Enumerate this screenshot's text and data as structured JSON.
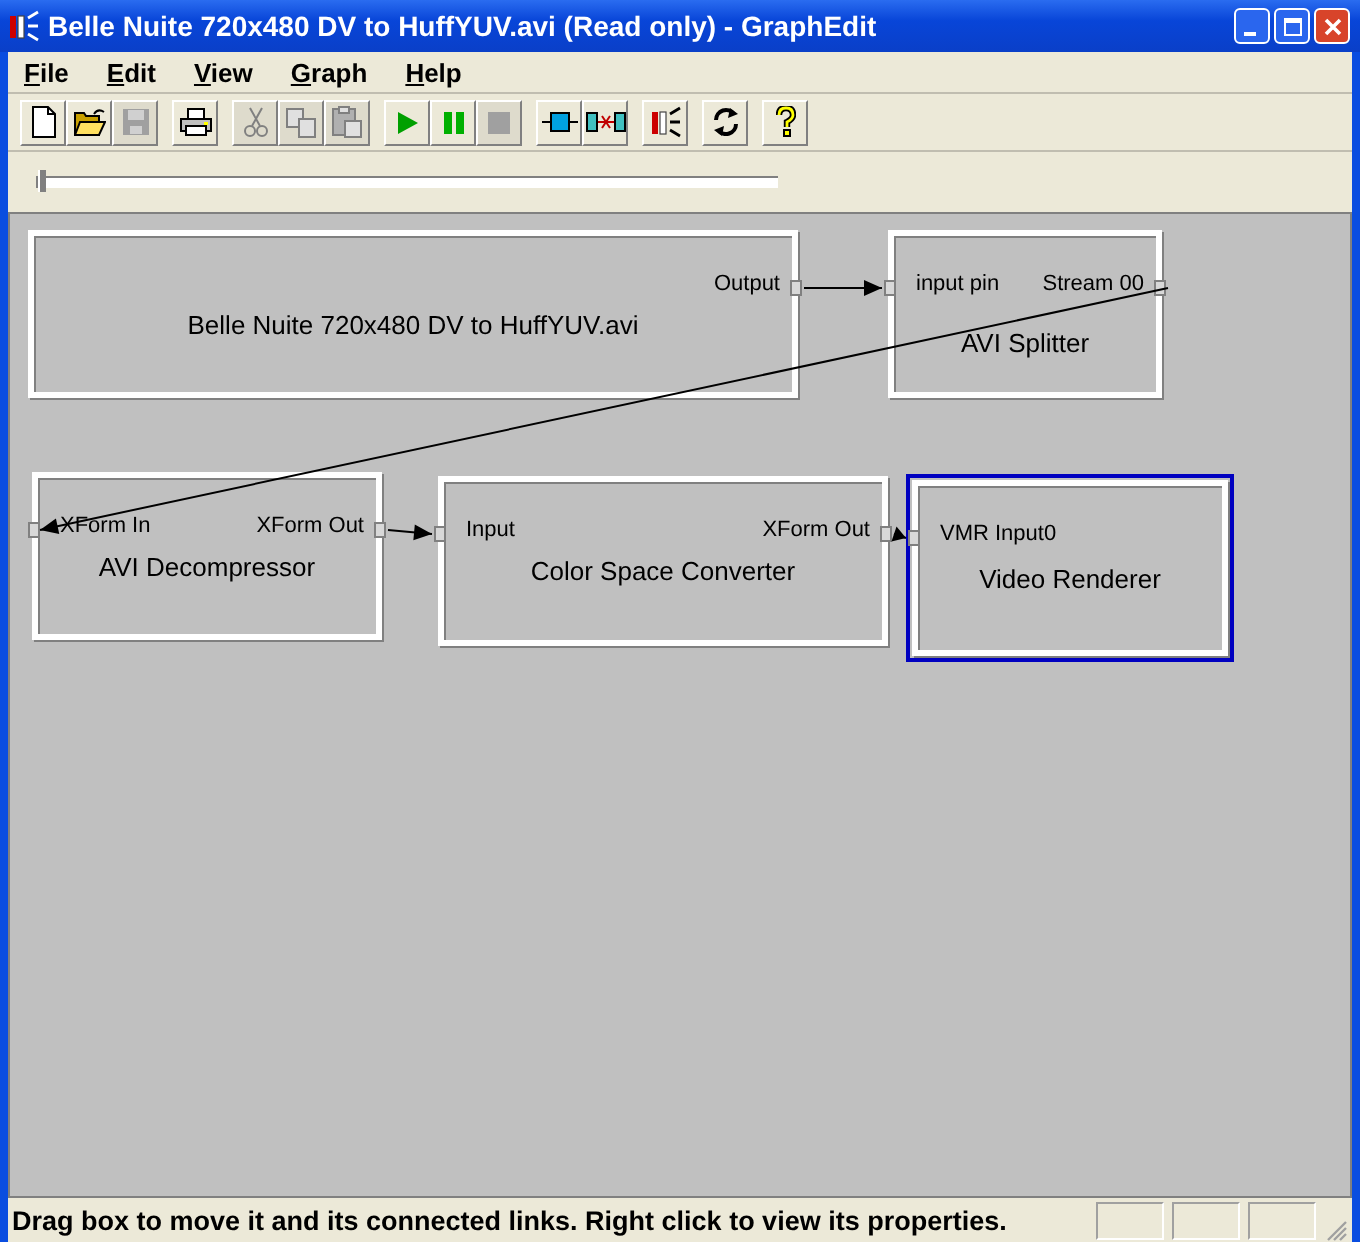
{
  "window": {
    "title": "Belle Nuite 720x480 DV to HuffYUV.avi (Read only) - GraphEdit"
  },
  "menu": [
    "File",
    "Edit",
    "View",
    "Graph",
    "Help"
  ],
  "toolbar_groups": [
    [
      {
        "kind": "new",
        "disabled": false
      },
      {
        "kind": "open",
        "disabled": false
      },
      {
        "kind": "save",
        "disabled": true
      }
    ],
    [
      {
        "kind": "print",
        "disabled": false
      }
    ],
    [
      {
        "kind": "cut",
        "disabled": true
      },
      {
        "kind": "copy",
        "disabled": true
      },
      {
        "kind": "paste",
        "disabled": true
      }
    ],
    [
      {
        "kind": "play",
        "disabled": false
      },
      {
        "kind": "pause",
        "disabled": false
      },
      {
        "kind": "stop",
        "disabled": true
      }
    ],
    [
      {
        "kind": "filter",
        "disabled": false
      },
      {
        "kind": "connect",
        "disabled": false
      }
    ],
    [
      {
        "kind": "graph",
        "disabled": false
      }
    ],
    [
      {
        "kind": "refresh",
        "disabled": false
      }
    ],
    [
      {
        "kind": "help",
        "disabled": false
      }
    ]
  ],
  "seek_bar": {
    "level": 0
  },
  "filters": [
    {
      "name": "Belle Nuite 720x480 DV to HuffYUV.avi",
      "selected": false,
      "pins": [
        {
          "label": "Output",
          "kind": "output"
        }
      ]
    },
    {
      "name": "AVI Splitter",
      "selected": false,
      "pins": [
        {
          "label": "input pin",
          "kind": "input"
        },
        {
          "label": "Stream 00",
          "kind": "output"
        }
      ]
    },
    {
      "name": "AVI Decompressor",
      "selected": false,
      "pins": [
        {
          "label": "XForm In",
          "kind": "input"
        },
        {
          "label": "XForm Out",
          "kind": "output"
        }
      ]
    },
    {
      "name": "Color Space Converter",
      "selected": false,
      "pins": [
        {
          "label": "Input",
          "kind": "input"
        },
        {
          "label": "XForm Out",
          "kind": "output"
        }
      ]
    },
    {
      "name": "Video Renderer",
      "selected": true,
      "pins": [
        {
          "label": "VMR Input0",
          "kind": "input"
        }
      ]
    }
  ],
  "status_bar": {
    "text": "Drag box to move it and its connected links. Right click to view its properties."
  }
}
